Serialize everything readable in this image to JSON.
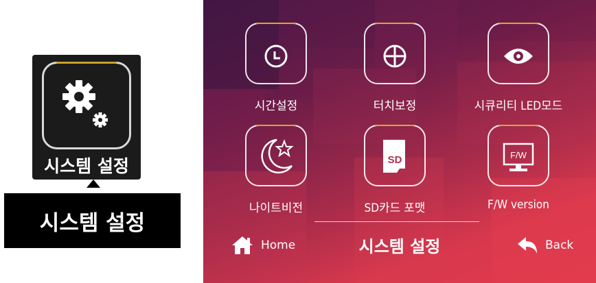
{
  "callout": {
    "tile_label": "시스템 설정",
    "box_label": "시스템 설정",
    "icon": "gear-icon"
  },
  "screen": {
    "tiles": [
      {
        "label": "시간설정",
        "icon": "clock-icon"
      },
      {
        "label": "터치보정",
        "icon": "crosshair-icon"
      },
      {
        "label": "시큐리티 LED모드",
        "icon": "eye-icon"
      },
      {
        "label": "나이트비전",
        "icon": "moon-star-icon"
      },
      {
        "label": "SD카드 포맷",
        "icon": "sd-card-icon",
        "icon_text": "SD"
      },
      {
        "label": "F/W version",
        "icon": "monitor-icon",
        "icon_text": "F/W"
      }
    ],
    "nav": {
      "home_label": "Home",
      "title": "시스템 설정",
      "back_label": "Back"
    },
    "colors": {
      "accent_gold": "#d8a830",
      "bg_dark": "#4a1848",
      "bg_light": "#e03a4c"
    }
  }
}
